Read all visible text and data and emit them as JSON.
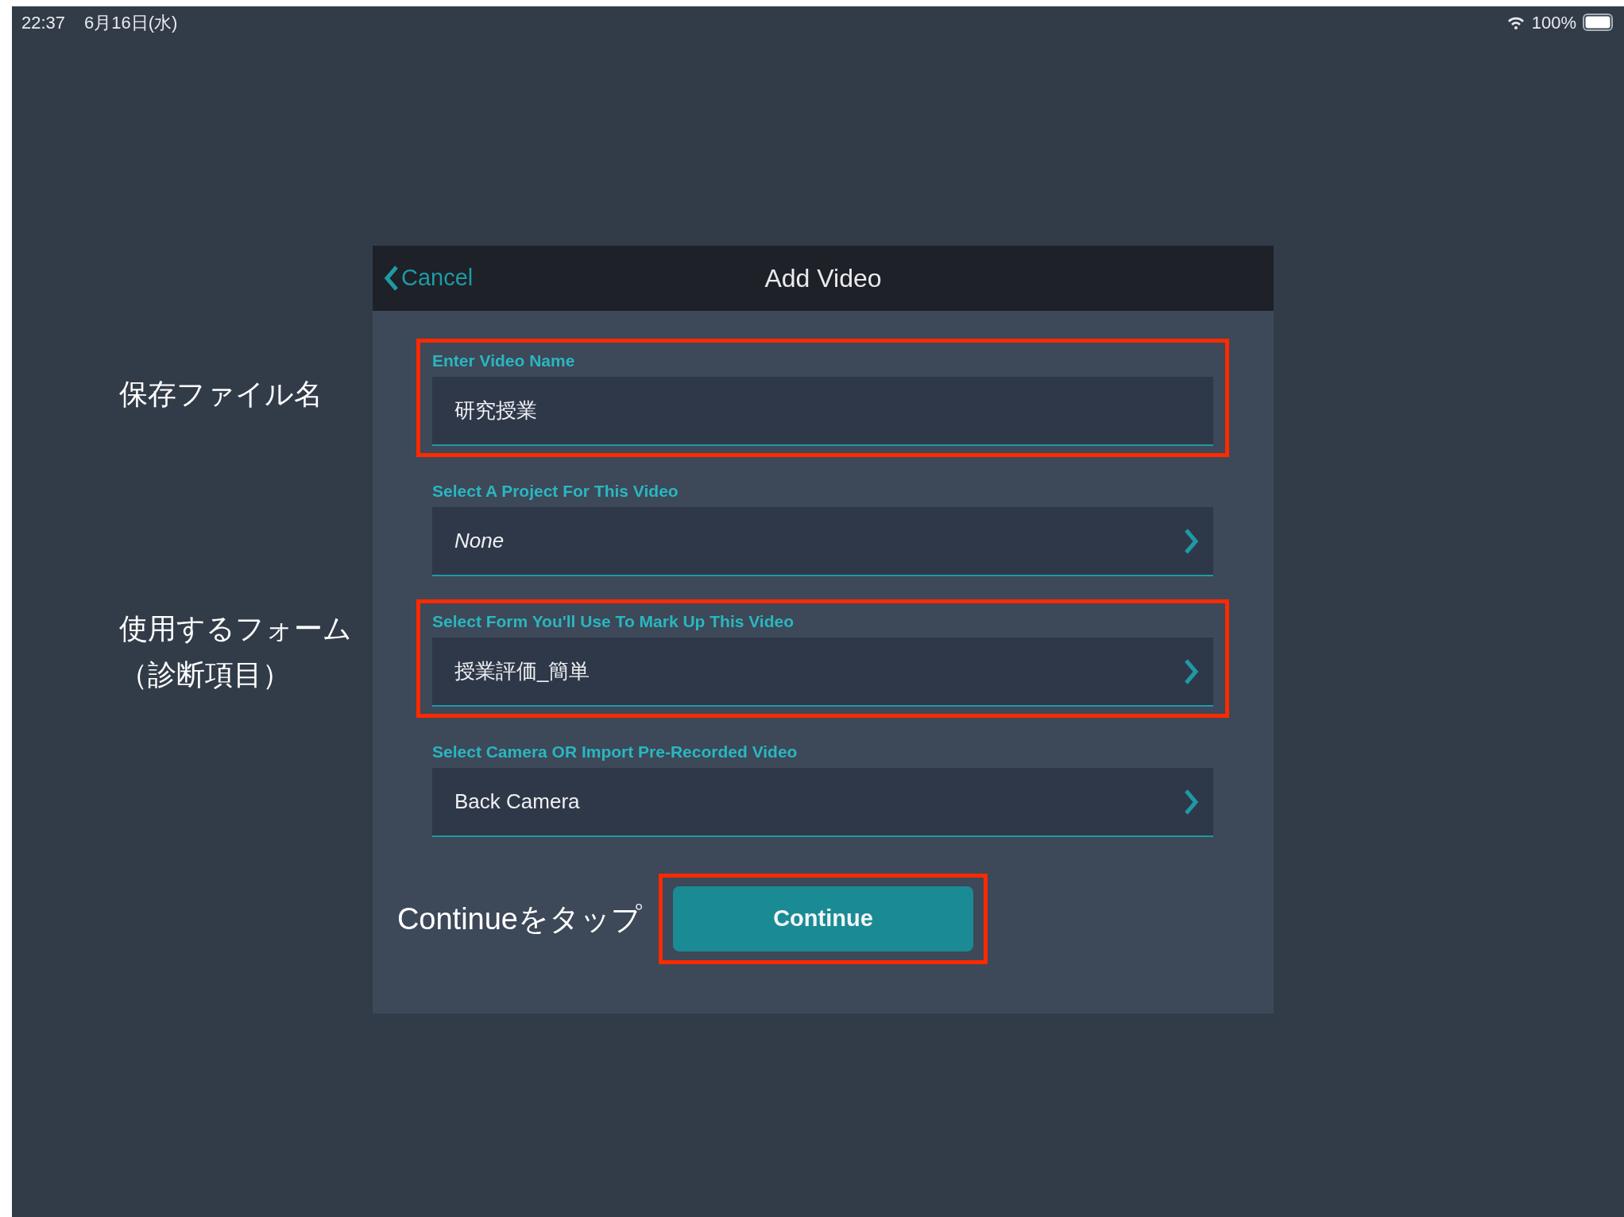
{
  "status_bar": {
    "time": "22:37",
    "date": "6月16日(水)",
    "battery": "100%"
  },
  "dialog": {
    "back_label": "Cancel",
    "title": "Add Video",
    "fields": [
      {
        "kind": "input",
        "label": "Enter Video Name",
        "value": "研究授業",
        "highlighted": true
      },
      {
        "kind": "select",
        "label": "Select A Project For This Video",
        "placeholder": "None",
        "highlighted": false
      },
      {
        "kind": "select",
        "label": "Select Form You'll Use To Mark Up This Video",
        "value": "授業評価_簡単",
        "highlighted": true
      },
      {
        "kind": "select",
        "label": "Select Camera OR Import Pre-Recorded Video",
        "value": "Back Camera",
        "highlighted": false
      }
    ],
    "continue_button": {
      "label": "Continue",
      "highlighted": true
    },
    "continue_hint": "Continueをタップ"
  },
  "annotations": [
    {
      "text": "保存ファイル名"
    },
    {
      "text": "使用するフォーム"
    },
    {
      "text": "（診断項目）"
    }
  ]
}
